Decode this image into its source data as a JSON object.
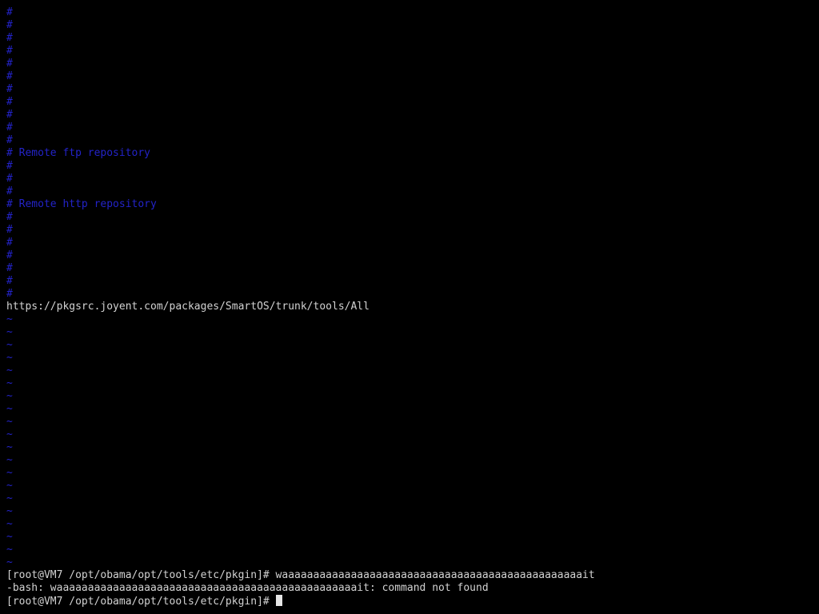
{
  "editor": {
    "lines": [
      {
        "kind": "comment",
        "text": "#"
      },
      {
        "kind": "comment",
        "text": "#"
      },
      {
        "kind": "comment",
        "text": "#"
      },
      {
        "kind": "comment",
        "text": "#"
      },
      {
        "kind": "comment",
        "text": "#"
      },
      {
        "kind": "comment",
        "text": "#"
      },
      {
        "kind": "comment",
        "text": "#"
      },
      {
        "kind": "comment",
        "text": "#"
      },
      {
        "kind": "comment",
        "text": "#"
      },
      {
        "kind": "comment",
        "text": "#"
      },
      {
        "kind": "comment",
        "text": "#"
      },
      {
        "kind": "comment",
        "text": "# Remote ftp repository"
      },
      {
        "kind": "comment",
        "text": "#"
      },
      {
        "kind": "comment",
        "text": "#"
      },
      {
        "kind": "comment",
        "text": "#"
      },
      {
        "kind": "comment",
        "text": "# Remote http repository"
      },
      {
        "kind": "comment",
        "text": "#"
      },
      {
        "kind": "comment",
        "text": "#"
      },
      {
        "kind": "comment",
        "text": "#"
      },
      {
        "kind": "comment",
        "text": "#"
      },
      {
        "kind": "comment",
        "text": "#"
      },
      {
        "kind": "comment",
        "text": "#"
      },
      {
        "kind": "comment",
        "text": "#"
      },
      {
        "kind": "url",
        "text": "https://pkgsrc.joyent.com/packages/SmartOS/trunk/tools/All"
      }
    ],
    "tilde_marker": "~",
    "tilde_count": 20
  },
  "shell": {
    "lines": [
      "[root@VM7 /opt/obama/opt/tools/etc/pkgin]# waaaaaaaaaaaaaaaaaaaaaaaaaaaaaaaaaaaaaaaaaaaaaaaait",
      "-bash: waaaaaaaaaaaaaaaaaaaaaaaaaaaaaaaaaaaaaaaaaaaaaaaait: command not found"
    ],
    "prompt": "[root@VM7 /opt/obama/opt/tools/etc/pkgin]# "
  },
  "colors": {
    "background": "#000000",
    "comment": "#2323c8",
    "text": "#d2d2d2",
    "cursor": "#e6e6e6"
  }
}
